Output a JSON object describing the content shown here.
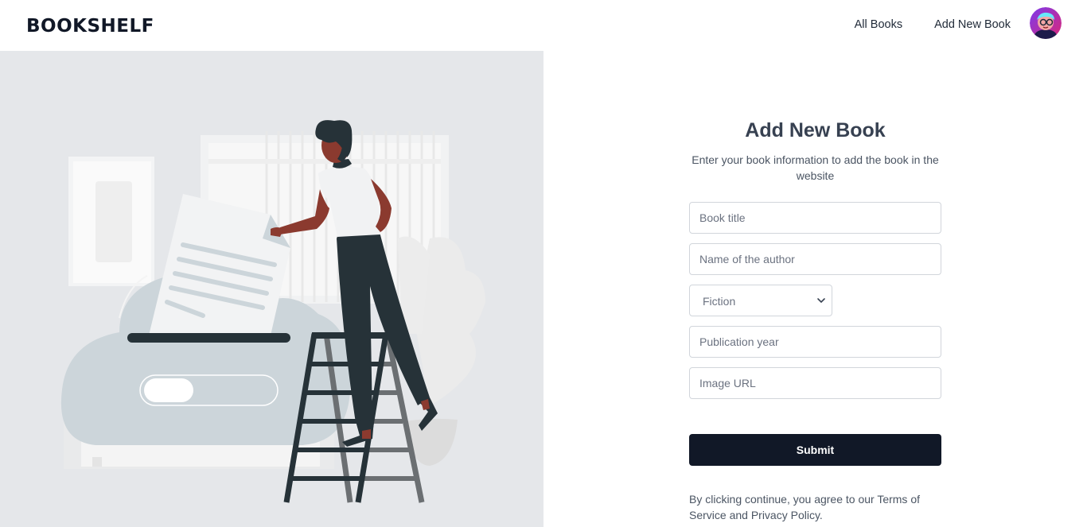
{
  "nav": {
    "brand": "BOOKSHELF",
    "links": [
      "All Books",
      "Add New Book"
    ]
  },
  "form": {
    "title": "Add New Book",
    "subtitle": "Enter your book information to add the book in the website",
    "fields": {
      "title_placeholder": "Book title",
      "author_placeholder": "Name of the author",
      "genre_value": "Fiction",
      "year_placeholder": "Publication year",
      "image_placeholder": "Image URL"
    },
    "submit_label": "Submit",
    "terms": "By clicking continue, you agree to our Terms of Service and Privacy Policy."
  },
  "illustration": {
    "icon": "person-filing-document-illustration"
  },
  "colors": {
    "primary": "#111827",
    "illustration_bg": "#e5e7ea",
    "skin": "#8b3a2f",
    "dark": "#263238"
  }
}
